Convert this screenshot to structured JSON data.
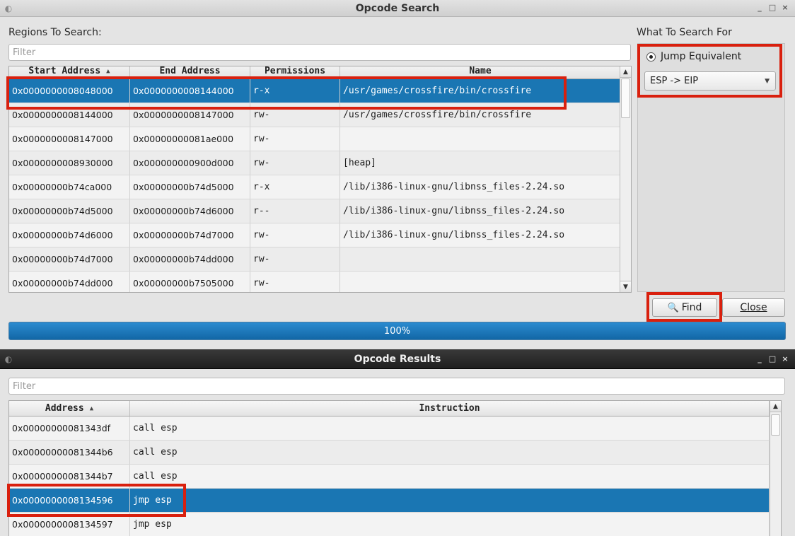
{
  "search_window": {
    "title": "Opcode Search",
    "wm_buttons": [
      "_",
      "□",
      "×"
    ],
    "regions_label": "Regions To Search:",
    "filter_placeholder": "Filter",
    "columns": [
      "Start Address",
      "End Address",
      "Permissions",
      "Name"
    ],
    "rows": [
      {
        "start": "0x0000000008048000",
        "end": "0x0000000008144000",
        "perm": "r-x",
        "name": "/usr/games/crossfire/bin/crossfire",
        "selected": true
      },
      {
        "start": "0x0000000008144000",
        "end": "0x0000000008147000",
        "perm": "rw-",
        "name": "/usr/games/crossfire/bin/crossfire"
      },
      {
        "start": "0x0000000008147000",
        "end": "0x00000000081ae000",
        "perm": "rw-",
        "name": ""
      },
      {
        "start": "0x0000000008930000",
        "end": "0x000000000900d000",
        "perm": "rw-",
        "name": "[heap]"
      },
      {
        "start": "0x00000000b74ca000",
        "end": "0x00000000b74d5000",
        "perm": "r-x",
        "name": "/lib/i386-linux-gnu/libnss_files-2.24.so"
      },
      {
        "start": "0x00000000b74d5000",
        "end": "0x00000000b74d6000",
        "perm": "r--",
        "name": "/lib/i386-linux-gnu/libnss_files-2.24.so"
      },
      {
        "start": "0x00000000b74d6000",
        "end": "0x00000000b74d7000",
        "perm": "rw-",
        "name": "/lib/i386-linux-gnu/libnss_files-2.24.so"
      },
      {
        "start": "0x00000000b74d7000",
        "end": "0x00000000b74dd000",
        "perm": "rw-",
        "name": ""
      },
      {
        "start": "0x00000000b74dd000",
        "end": "0x00000000b7505000",
        "perm": "rw-",
        "name": ""
      }
    ],
    "search_for_label": "What To Search For",
    "radio_label": "Jump Equivalent",
    "select_value": "ESP -> EIP",
    "find_label": "Find",
    "close_label": "Close",
    "progress_text": "100%",
    "progress": 100
  },
  "results_window": {
    "title": "Opcode Results",
    "wm_buttons": [
      "_",
      "□",
      "×"
    ],
    "filter_placeholder": "Filter",
    "columns": [
      "Address",
      "Instruction"
    ],
    "rows": [
      {
        "address": "0x00000000081343df",
        "instruction": "call esp"
      },
      {
        "address": "0x00000000081344b6",
        "instruction": "call esp"
      },
      {
        "address": "0x00000000081344b7",
        "instruction": "call esp"
      },
      {
        "address": "0x0000000008134596",
        "instruction": "jmp esp",
        "selected": true
      },
      {
        "address": "0x0000000008134597",
        "instruction": "jmp esp"
      }
    ]
  },
  "colors": {
    "selection": "#1a76b3",
    "highlight_box": "#d9200e",
    "progress": "#1a76b3"
  }
}
